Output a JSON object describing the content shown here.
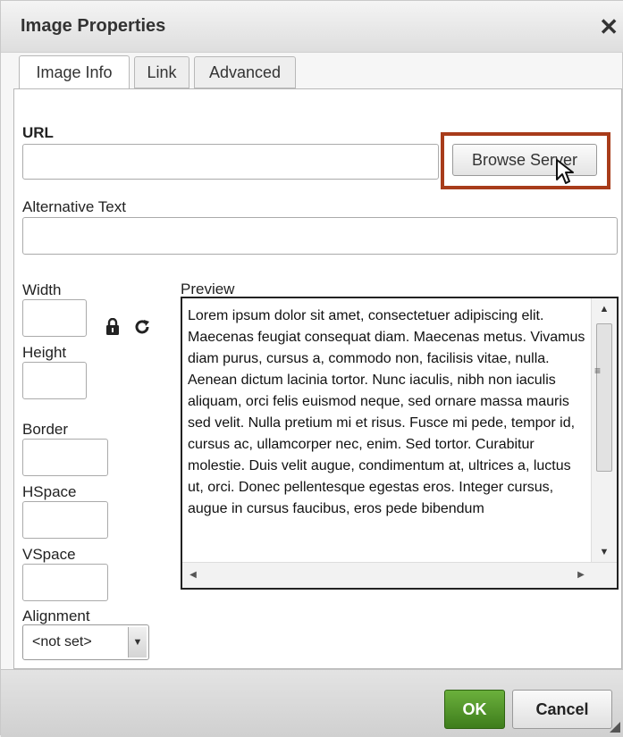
{
  "dialog": {
    "title": "Image Properties",
    "close_glyph": "✕",
    "tabs": [
      {
        "label": "Image Info",
        "active": true
      },
      {
        "label": "Link",
        "active": false
      },
      {
        "label": "Advanced",
        "active": false
      }
    ]
  },
  "form": {
    "url_label": "URL",
    "url_value": "",
    "browse_button": "Browse Server",
    "alt_label": "Alternative Text",
    "alt_value": "",
    "width_label": "Width",
    "height_label": "Height",
    "border_label": "Border",
    "hspace_label": "HSpace",
    "vspace_label": "VSpace",
    "alignment_label": "Alignment",
    "alignment_value": "<not set>",
    "preview_label": "Preview"
  },
  "preview": {
    "text": "Lorem ipsum dolor sit amet, consectetuer adipiscing elit. Maecenas feugiat consequat diam. Maecenas metus. Vivamus diam purus, cursus a, commodo non, facilisis vitae, nulla. Aenean dictum lacinia tortor. Nunc iaculis, nibh non iaculis aliquam, orci felis euismod neque, sed ornare massa mauris sed velit. Nulla pretium mi et risus. Fusce mi pede, tempor id, cursus ac, ullamcorper nec, enim. Sed tortor. Curabitur molestie. Duis velit augue, condimentum at, ultrices a, luctus ut, orci. Donec pellentesque egestas eros. Integer cursus, augue in cursus faucibus, eros pede bibendum"
  },
  "footer": {
    "ok_label": "OK",
    "cancel_label": "Cancel"
  },
  "icons": {
    "lock": "lock-icon",
    "reset": "reset-size-icon"
  },
  "colors": {
    "highlight_border": "#a83c1a",
    "ok_button": "#4e8f2a"
  }
}
